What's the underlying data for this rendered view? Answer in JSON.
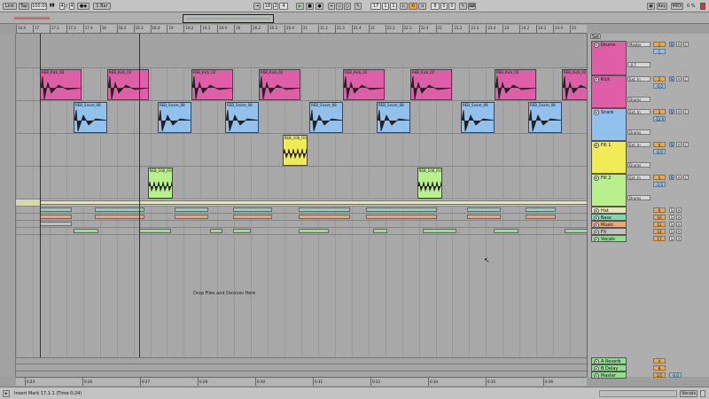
{
  "topbar": {
    "link": "Link",
    "tap": "Tap",
    "tempo": "100.00",
    "sig_num": "4",
    "sig_den": "4",
    "metro": "1 Bar",
    "pos_bar": "18",
    "pos_beat": "2",
    "pos_sixteenth": "4",
    "loop_start_bar": "17",
    "loop_start_beat": "1",
    "loop_start_sixteenth": "1",
    "loop_len_bar": "8",
    "loop_len_beat": "0",
    "loop_len_sixteenth": "0",
    "key": "Key",
    "midi": "MIDI",
    "cpu": "0 %"
  },
  "ruler_ticks": [
    "16.4",
    "17",
    "17.2",
    "17.3",
    "17.4",
    "18",
    "18.2",
    "18.3",
    "18.4",
    "19",
    "19.2",
    "19.3",
    "19.4",
    "20",
    "20.2",
    "20.3",
    "20.4",
    "21",
    "21.2",
    "21.3",
    "21.4",
    "22",
    "22.2",
    "22.3",
    "22.4",
    "23",
    "23.2",
    "23.3",
    "23.4",
    "24",
    "24.2",
    "24.3",
    "24.4",
    "25"
  ],
  "time_ticks": [
    "0:24",
    "0:26",
    "0:27",
    "0:28",
    "0:30",
    "0:31",
    "0:32",
    "0:34",
    "0:35",
    "0:36"
  ],
  "drop_text": "Drop Files and Devices Here",
  "status_text": "Insert Mark 17.1.1 (Time 0:24)",
  "status_track": "Vocals",
  "set_button": "Set",
  "colors": {
    "kick": "#de5fa8",
    "snare": "#92c1ee",
    "fill1": "#f1eb56",
    "fill2": "#b7f08c",
    "drums": "#de5fa8",
    "hat": "#e6e6b0",
    "bass": "#7ed8b0",
    "music": "#f2a46e",
    "fx": "#c0c0c0",
    "vocals": "#8fe08a",
    "returns": "#8fe08a"
  },
  "tracks": [
    {
      "name": "Drums",
      "routing": "Master",
      "vol": "1",
      "pan": "C",
      "num": "1",
      "sends": "-0.7",
      "kind": "group"
    },
    {
      "name": "Kick",
      "routing": "Ext. In",
      "vol": "2",
      "pan": "-0.0",
      "num": "2",
      "sends": "Drums",
      "kind": "audio"
    },
    {
      "name": "Snare",
      "routing": "Ext. In",
      "vol": "3",
      "pan": "-12.0",
      "num": "3",
      "sends": "Drums",
      "kind": "audio"
    },
    {
      "name": "Fill 1",
      "routing": "Ext. In",
      "vol": "4",
      "pan": "-6.0",
      "num": "4",
      "sends": "Drums",
      "kind": "audio"
    },
    {
      "name": "Fill 2",
      "routing": "Ext. In",
      "vol": "5",
      "pan": "-2.0",
      "num": "5",
      "sends": "Drums",
      "kind": "audio"
    },
    {
      "name": "Hat",
      "num": "6",
      "kind": "small"
    },
    {
      "name": "Bass",
      "num": "10",
      "kind": "small"
    },
    {
      "name": "Music",
      "num": "11",
      "kind": "small"
    },
    {
      "name": "FX",
      "num": "14",
      "kind": "small"
    },
    {
      "name": "Vocals",
      "num": "17",
      "kind": "small"
    }
  ],
  "returns": [
    {
      "name": "A Reverb",
      "num": "A"
    },
    {
      "name": "B Delay",
      "num": "B"
    },
    {
      "name": "Master",
      "num": "1/2",
      "vol": "-0.0"
    }
  ],
  "clips": {
    "kick": [
      {
        "name": "REB_Kick_02",
        "start": 0.0
      },
      {
        "name": "REB_Kick_02",
        "start": 1.0
      },
      {
        "name": "REB_Kick_02",
        "start": 2.25
      },
      {
        "name": "REB_Kick_02",
        "start": 3.25
      },
      {
        "name": "REB_Kick_02",
        "start": 4.5
      },
      {
        "name": "REB_Kick_02",
        "start": 5.5
      },
      {
        "name": "REB_Kick_02",
        "start": 6.75
      },
      {
        "name": "REB_Kick_02",
        "start": 7.75
      }
    ],
    "snare": [
      {
        "name": "REB_Snare_08",
        "start": 0.5
      },
      {
        "name": "REB_Snare_08",
        "start": 1.75
      },
      {
        "name": "REB_Snare_08",
        "start": 2.75
      },
      {
        "name": "REB_Snare_08",
        "start": 4.0
      },
      {
        "name": "REB_Snare_08",
        "start": 5.0
      },
      {
        "name": "REB_Snare_08",
        "start": 6.25
      },
      {
        "name": "REB_Snare_08",
        "start": 7.25
      },
      {
        "name": "REB_Snare_08",
        "start": 8.5
      }
    ],
    "fill1": [
      {
        "name": "REB_100_Fill",
        "start": 3.6
      },
      {
        "name": "REB_100_Fill",
        "start": 8.6
      }
    ],
    "fill2": [
      {
        "name": "REB_100_Fill",
        "start": 1.6
      },
      {
        "name": "REB_100_Fill",
        "start": 5.6
      }
    ]
  }
}
